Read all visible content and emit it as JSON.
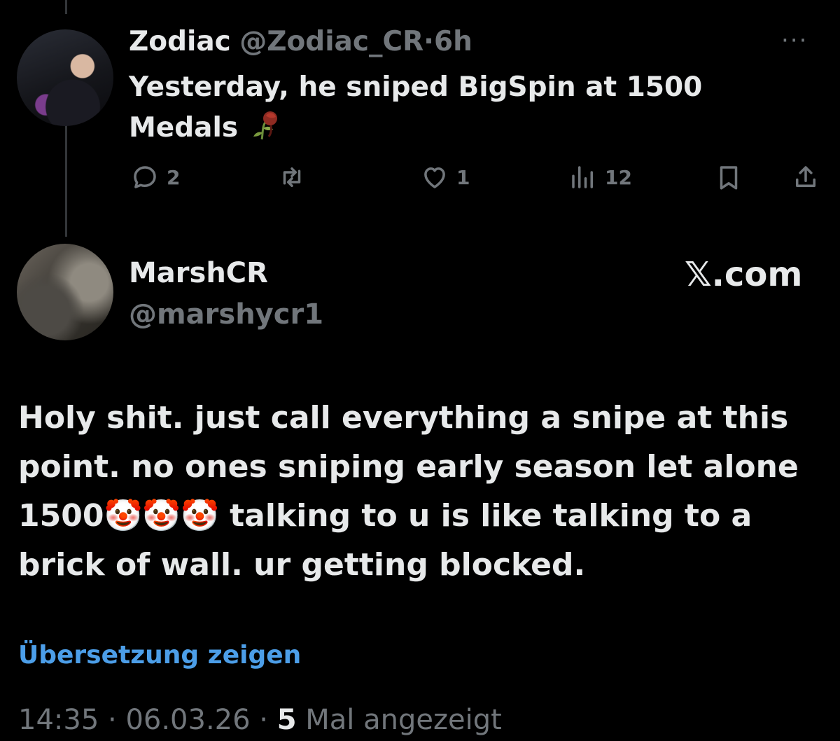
{
  "parent_tweet": {
    "display_name": "Zodiac",
    "handle": "@Zodiac_CR",
    "separator": "·",
    "time_ago": "6h",
    "text": "Yesterday, he sniped BigSpin at 1500 Medals",
    "emoji_icon": "wilted-rose-icon",
    "more_icon": "···",
    "actions": {
      "reply_count": "2",
      "retweet_count": "",
      "like_count": "1",
      "views_count": "12"
    }
  },
  "main_tweet": {
    "display_name": "MarshCR",
    "handle": "@marshycr1",
    "source_badge": "𝕏.com",
    "text": "Holy shit. just call everything a snipe at this point. no ones sniping early season let alone 1500🤡🤡🤡 talking to u is like talking to a brick of wall. ur getting blocked.",
    "translate_link": "Übersetzung zeigen",
    "time": "14:35",
    "date": "06.03.26",
    "separator": "·",
    "views_number": "5",
    "views_label": "Mal angezeigt"
  },
  "colors": {
    "background": "#000000",
    "text": "#e7e9ea",
    "muted": "#71767b",
    "link": "#4c9ee8",
    "thread_line": "#333639"
  }
}
